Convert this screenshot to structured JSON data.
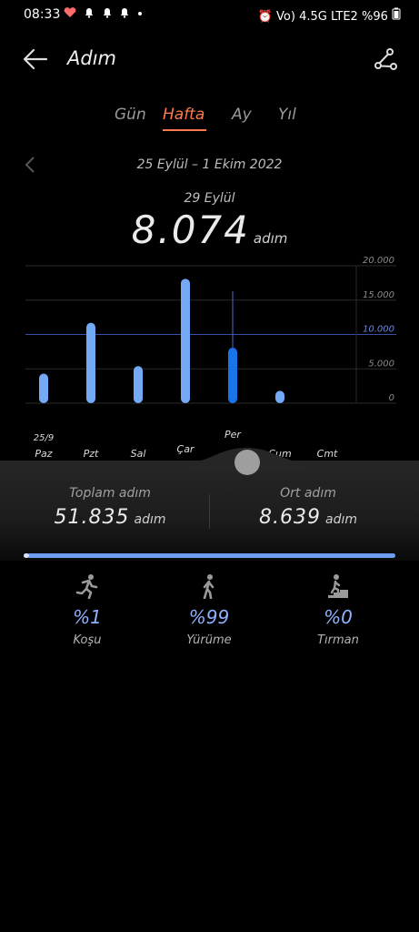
{
  "status_bar": {
    "time": "08:33",
    "left_icons": [
      "heart-rate-icon",
      "mail-icon",
      "bell-icon",
      "bell-icon",
      "dot"
    ],
    "right_text": "Vo) 4.5G LTE2 %96",
    "battery": "96"
  },
  "header": {
    "title": "Adım"
  },
  "tabs": [
    {
      "label": "Gün",
      "active": false
    },
    {
      "label": "Hafta",
      "active": true
    },
    {
      "label": "Ay",
      "active": false
    },
    {
      "label": "Yıl",
      "active": false
    }
  ],
  "date_range": "25 Eylül – 1 Ekim 2022",
  "selected": {
    "date": "29 Eylül",
    "value": "8.074",
    "unit": "adım"
  },
  "chart_data": {
    "type": "bar",
    "categories": [
      "Paz",
      "Pzt",
      "Sal",
      "Çar",
      "Per",
      "Cum",
      "Cmt"
    ],
    "first_date_label": "25/9",
    "values": [
      4300,
      11700,
      5400,
      18100,
      8074,
      1800,
      0
    ],
    "selected_index": 4,
    "ylim": [
      0,
      20000
    ],
    "yticks": [
      "20.000",
      "15.000",
      "10.000",
      "5.000",
      "0"
    ],
    "ytick_values": [
      20000,
      15000,
      10000,
      5000,
      0
    ],
    "average_line": 10000,
    "colors": {
      "bar": "#74aaf5",
      "selected_bar": "#1a73e8",
      "avg_line": "#3b4fa8",
      "grid": "#2a2a2a"
    }
  },
  "stats": {
    "total": {
      "label": "Toplam adım",
      "value": "51.835",
      "unit": "adım"
    },
    "average": {
      "label": "Ort adım",
      "value": "8.639",
      "unit": "adım"
    }
  },
  "activity_progress": 0.99,
  "activities": [
    {
      "name": "Koşu",
      "pct": "%1",
      "icon": "running-icon"
    },
    {
      "name": "Yürüme",
      "pct": "%99",
      "icon": "walking-icon"
    },
    {
      "name": "Tırman",
      "pct": "%0",
      "icon": "stairs-icon"
    }
  ]
}
